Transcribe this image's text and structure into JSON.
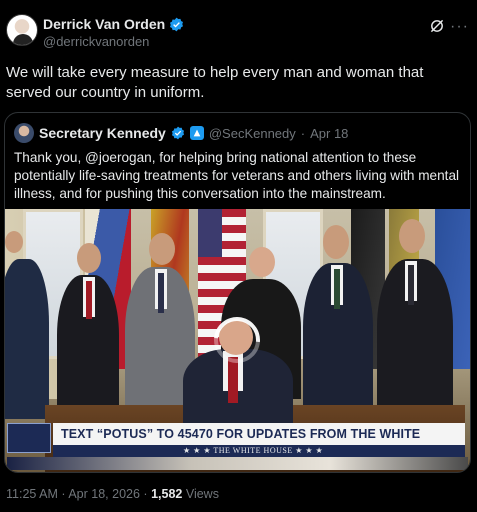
{
  "author": {
    "name": "Derrick Van Orden",
    "handle": "@derrickvanorden"
  },
  "tweet": {
    "text": "We will take every measure to help every man and woman that served our country in uniform."
  },
  "quote": {
    "name": "Secretary Kennedy",
    "handle": "@SecKennedy",
    "separator": "·",
    "date": "Apr 18",
    "text": "Thank you, @joerogan, for helping bring national attention to these potentially life-saving treatments for veterans and others living with mental illness, and for pushing this conversation into the mainstream.",
    "media": {
      "lower_third_text": "TEXT “POTUS” TO 45470 FOR UPDATES FROM THE WHITE HOUSE",
      "lower_third_sub": "★ ★ ★  THE WHITE HOUSE  ★ ★ ★",
      "loading": true
    }
  },
  "meta": {
    "time": "11:25 AM",
    "separator": "·",
    "date": "Apr 18, 2026",
    "views_count": "1,582",
    "views_label": "Views"
  },
  "icons": {
    "verified": "verified-badge-icon",
    "gov": "government-badge-icon",
    "grok": "grok-icon",
    "more": "more-icon"
  },
  "colors": {
    "background": "#000000",
    "text": "#e7e9ea",
    "secondary": "#71767b",
    "accent": "#1d9bf0",
    "border": "#2f3336"
  }
}
